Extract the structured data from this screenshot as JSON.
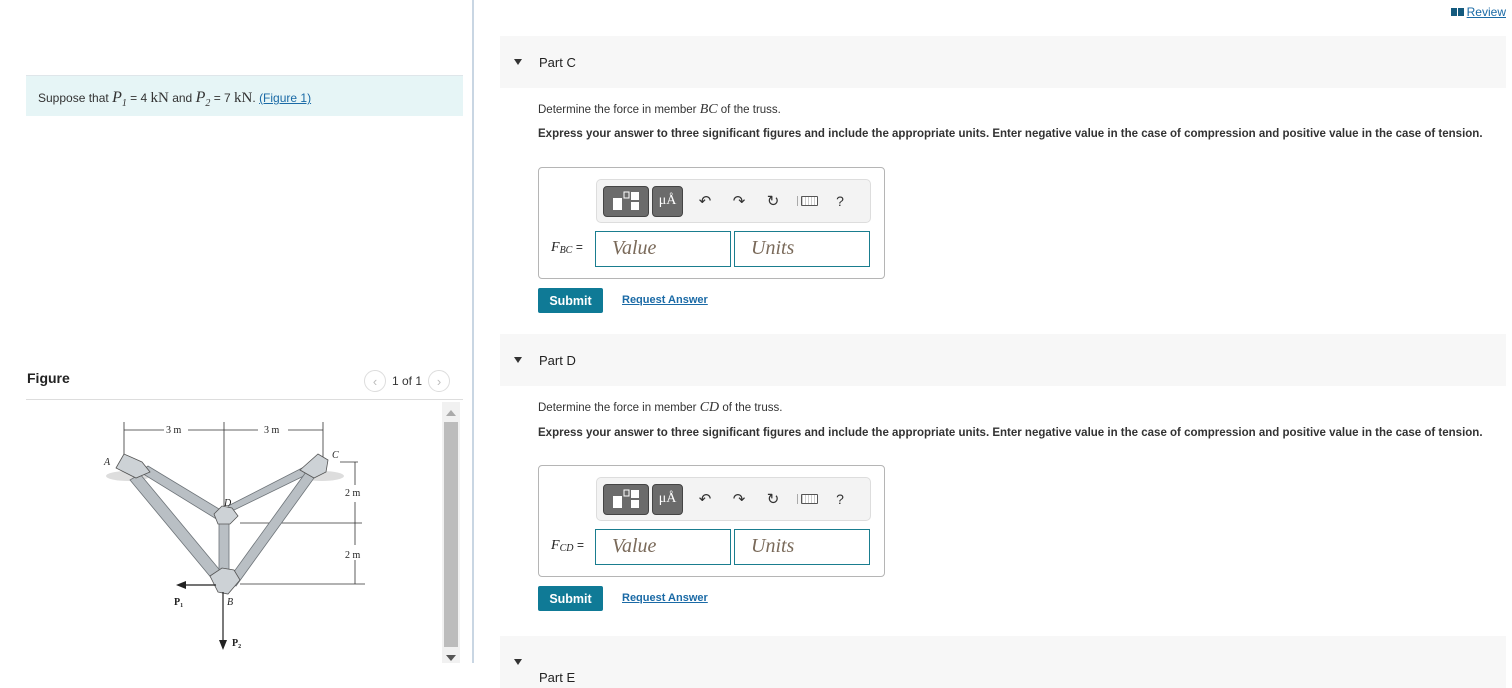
{
  "problem": {
    "prefix": "Suppose that ",
    "p1_symbol": "P",
    "p1_sub": "1",
    "p1_eq": " = 4 ",
    "p1_unit": "kN",
    "and": " and ",
    "p2_symbol": "P",
    "p2_sub": "2",
    "p2_eq": " = 7 ",
    "p2_unit": "kN",
    "period": ". ",
    "figure_link": "(Figure 1)"
  },
  "figure": {
    "title": "Figure",
    "pager_text": "1 of 1",
    "prev_icon": "chevron-left-icon",
    "next_icon": "chevron-right-icon",
    "labels": {
      "A": "A",
      "B": "B",
      "C": "C",
      "D": "D",
      "dim_left": "3 m",
      "dim_right": "3 m",
      "dim_upper": "2 m",
      "dim_lower": "2 m",
      "P1": "P",
      "P1_sub": "1",
      "P2": "P",
      "P2_sub": "2"
    }
  },
  "header": {
    "review_label": "Review",
    "review_icon": "book-icon"
  },
  "parts": [
    {
      "title": "Part C",
      "question_prefix": "Determine the force in member ",
      "member": "BC",
      "question_suffix": " of the truss.",
      "instructions": "Express your answer to three significant figures and include the appropriate units. Enter negative value in the case of compression and positive value in the case of tension.",
      "var_symbol": "F",
      "var_sub": "BC",
      "equals": "=",
      "value_placeholder": "Value",
      "units_placeholder": "Units",
      "submit_label": "Submit",
      "request_label": "Request Answer"
    },
    {
      "title": "Part D",
      "question_prefix": "Determine the force in member ",
      "member": "CD",
      "question_suffix": " of the truss.",
      "instructions": "Express your answer to three significant figures and include the appropriate units. Enter negative value in the case of compression and positive value in the case of tension.",
      "var_symbol": "F",
      "var_sub": "CD",
      "equals": "=",
      "value_placeholder": "Value",
      "units_placeholder": "Units",
      "submit_label": "Submit",
      "request_label": "Request Answer"
    },
    {
      "title": "Part E"
    }
  ],
  "toolbar": {
    "templates_icon": "templates-icon",
    "units_symbol": "μÅ",
    "undo_glyph": "↶",
    "redo_glyph": "↷",
    "reset_glyph": "↻",
    "help_glyph": "?"
  }
}
